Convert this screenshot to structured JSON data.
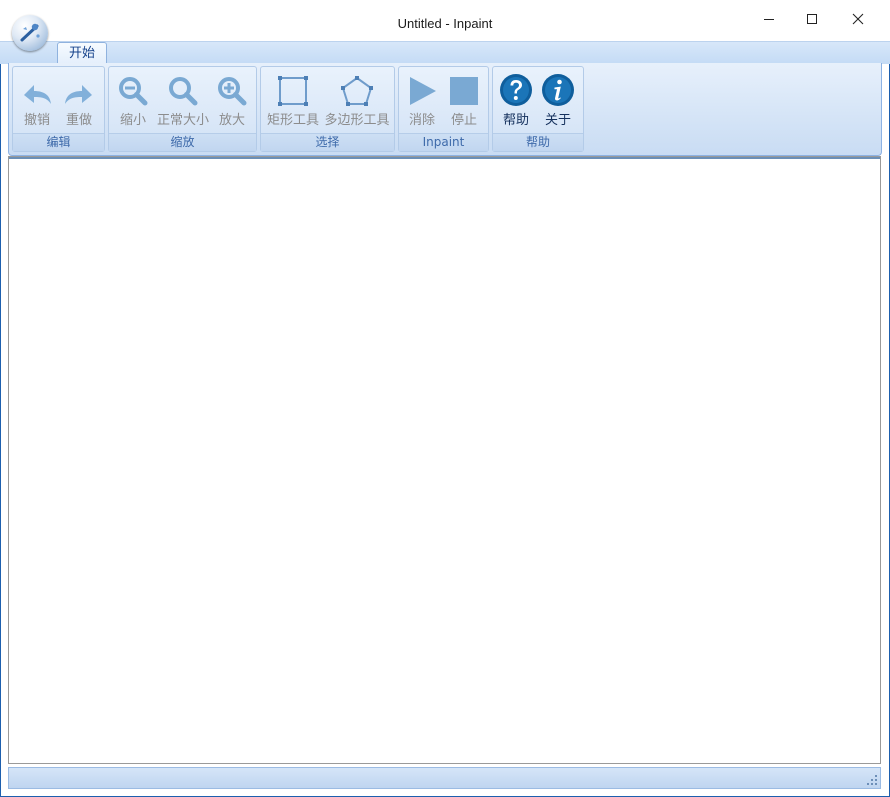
{
  "window": {
    "title": "Untitled - Inpaint",
    "controls": [
      "minimize-icon",
      "maximize-icon",
      "close-icon"
    ]
  },
  "app_menu": {
    "icon": "inpaint-app-orb-icon"
  },
  "ribbon": {
    "tabs": [
      {
        "label": "开始",
        "selected": true
      }
    ],
    "groups": [
      {
        "label": "编辑",
        "buttons": [
          {
            "label": "撤销",
            "icon": "undo-icon",
            "enabled": false
          },
          {
            "label": "重做",
            "icon": "redo-icon",
            "enabled": false
          }
        ]
      },
      {
        "label": "缩放",
        "buttons": [
          {
            "label": "缩小",
            "icon": "zoom-out-icon",
            "enabled": false
          },
          {
            "label": "正常大小",
            "icon": "zoom-normal-icon",
            "enabled": false
          },
          {
            "label": "放大",
            "icon": "zoom-in-icon",
            "enabled": false
          }
        ]
      },
      {
        "label": "选择",
        "buttons": [
          {
            "label": "矩形工具",
            "icon": "rectangle-tool-icon",
            "enabled": false
          },
          {
            "label": "多边形工具",
            "icon": "polygon-tool-icon",
            "enabled": false
          }
        ]
      },
      {
        "label": "Inpaint",
        "buttons": [
          {
            "label": "消除",
            "icon": "play-icon",
            "enabled": false
          },
          {
            "label": "停止",
            "icon": "stop-icon",
            "enabled": false
          }
        ]
      },
      {
        "label": "帮助",
        "buttons": [
          {
            "label": "帮助",
            "icon": "help-icon",
            "enabled": true
          },
          {
            "label": "关于",
            "icon": "info-icon",
            "enabled": true
          }
        ]
      }
    ]
  },
  "colors": {
    "ribbon_blue": "#c9dcf3",
    "icon_disabled_blue": "#7aa9d3",
    "icon_enabled_blue": "#0f5e9c",
    "group_label_text": "#3e6aaa",
    "desktop_blue": "#0f63c8"
  }
}
